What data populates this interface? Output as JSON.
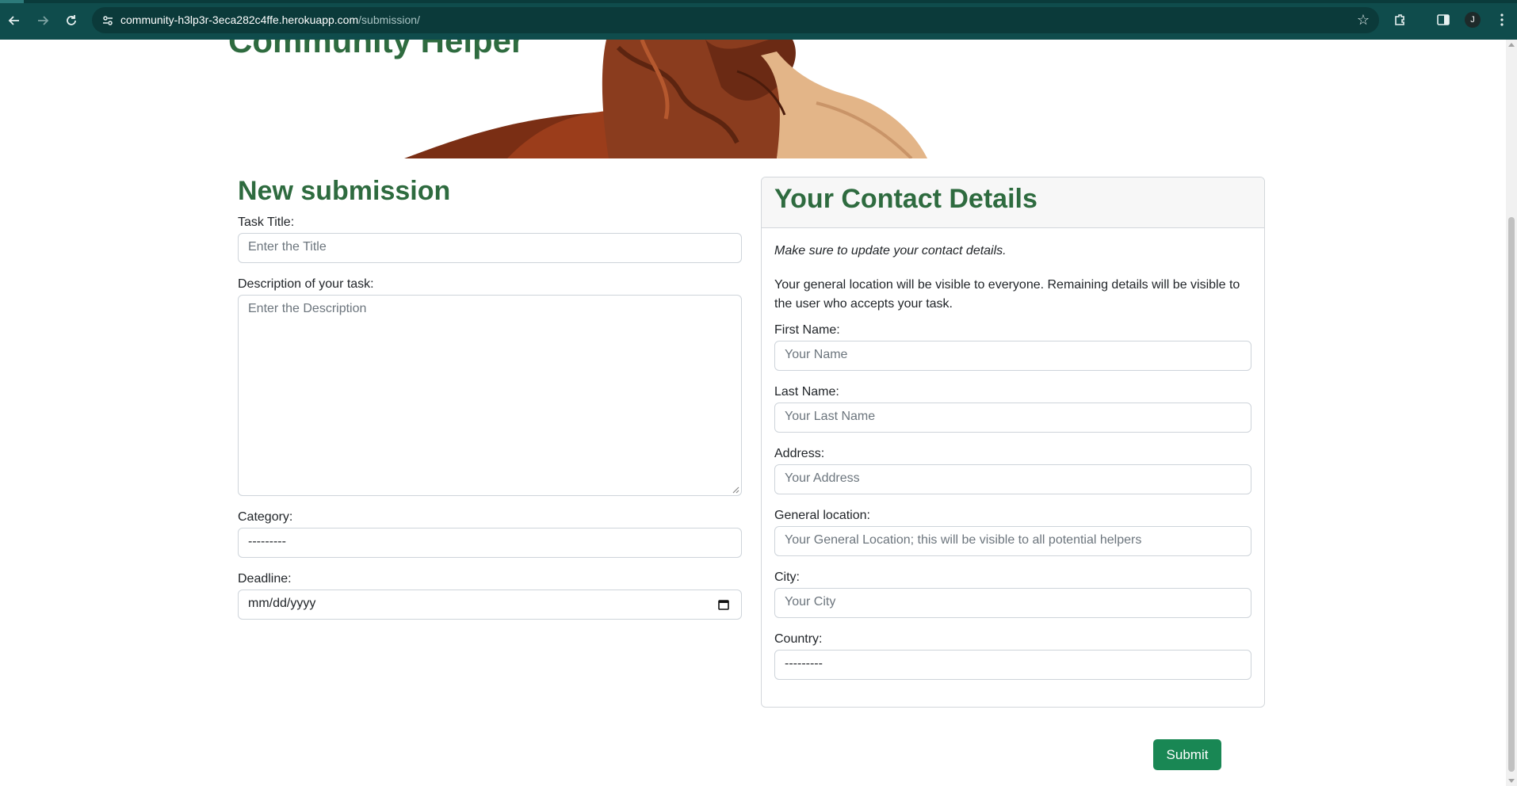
{
  "browser": {
    "url_host": "community-h3lp3r-3eca282c4ffe.herokuapp.com",
    "url_path": "/submission/",
    "profile_initial": "J"
  },
  "header": {
    "site_title": "Community Helper"
  },
  "task_form": {
    "heading": "New submission",
    "title_label": "Task Title:",
    "title_placeholder": "Enter the Title",
    "description_label": "Description of your task:",
    "description_placeholder": "Enter the Description",
    "category_label": "Category:",
    "category_value": "---------",
    "deadline_label": "Deadline:",
    "deadline_value": "mm/dd/yyyy"
  },
  "contact": {
    "heading": "Your Contact Details",
    "note": "Make sure to update your contact details.",
    "info": "Your general location will be visible to everyone. Remaining details will be visible to the user who accepts your task.",
    "first_name_label": "First Name:",
    "first_name_placeholder": "Your Name",
    "last_name_label": "Last Name:",
    "last_name_placeholder": "Your Last Name",
    "address_label": "Address:",
    "address_placeholder": "Your Address",
    "general_location_label": "General location:",
    "general_location_placeholder": "Your General Location; this will be visible to all potential helpers",
    "city_label": "City:",
    "city_placeholder": "Your City",
    "country_label": "Country:",
    "country_value": "---------"
  },
  "actions": {
    "submit_label": "Submit"
  },
  "colors": {
    "brand_green": "#2e6b3f",
    "submit_green": "#198754",
    "chrome_teal": "#0f4c4c"
  }
}
